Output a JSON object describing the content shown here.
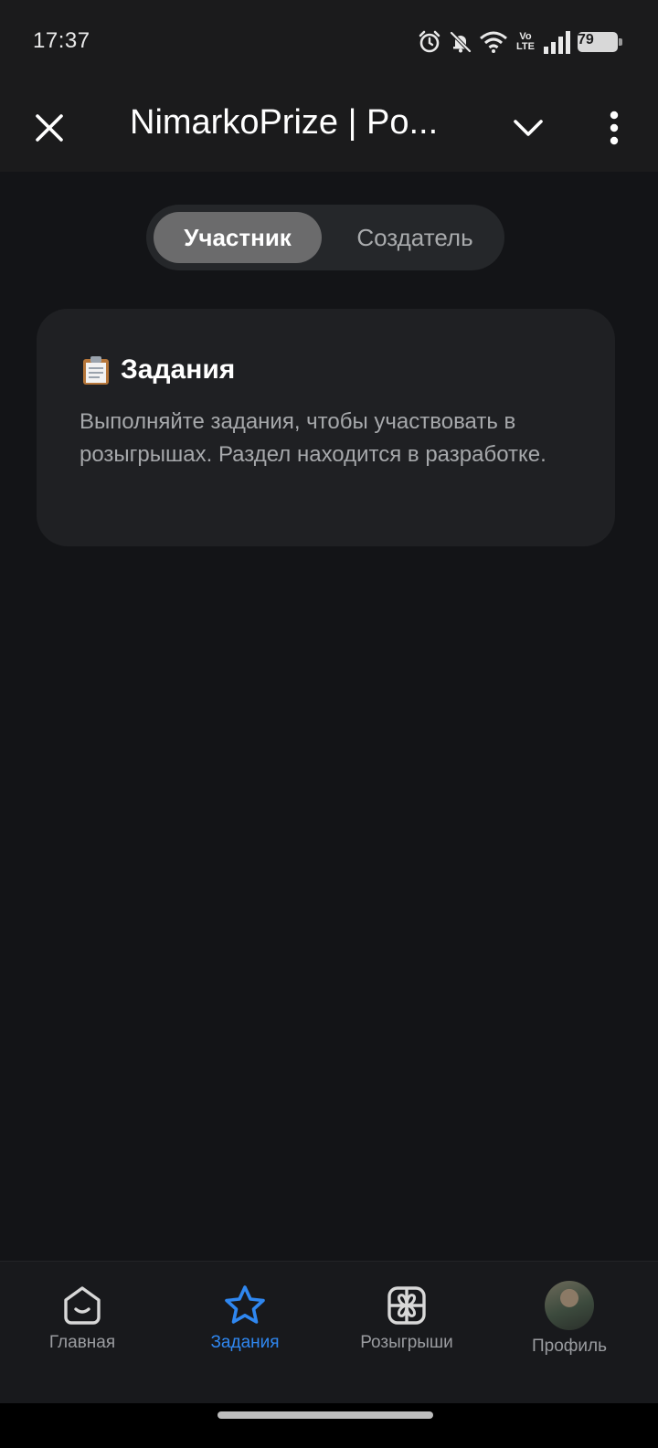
{
  "status_bar": {
    "time": "17:37",
    "volte_top": "Vo",
    "volte_bottom": "LTE",
    "battery": "79",
    "icons": [
      "alarm-icon",
      "bell-off-icon",
      "wifi-icon",
      "volte-icon",
      "signal-icon",
      "battery-icon"
    ]
  },
  "header": {
    "title": "NimarkoPrize | Po...",
    "icons": [
      "close-icon",
      "chevron-down-icon",
      "more-vertical-icon"
    ]
  },
  "segment": {
    "options": [
      "Участник",
      "Создатель"
    ],
    "selected": "Участник"
  },
  "card": {
    "emoji": "📋",
    "title": "Задания",
    "text": "Выполняйте задания, чтобы участвовать в розыгрышах. Раздел находится в разработке."
  },
  "bottom_nav": {
    "items": [
      {
        "label": "Главная",
        "icon": "home-icon"
      },
      {
        "label": "Задания",
        "icon": "star-icon"
      },
      {
        "label": "Розыгрыши",
        "icon": "gift-icon"
      },
      {
        "label": "Профиль",
        "icon": "avatar"
      }
    ],
    "active": "Задания"
  },
  "colors": {
    "background": "#131417",
    "bar": "#1b1b1c",
    "card": "#1f2023",
    "accent": "#2f87f0",
    "muted_text": "#a6a8ab"
  }
}
